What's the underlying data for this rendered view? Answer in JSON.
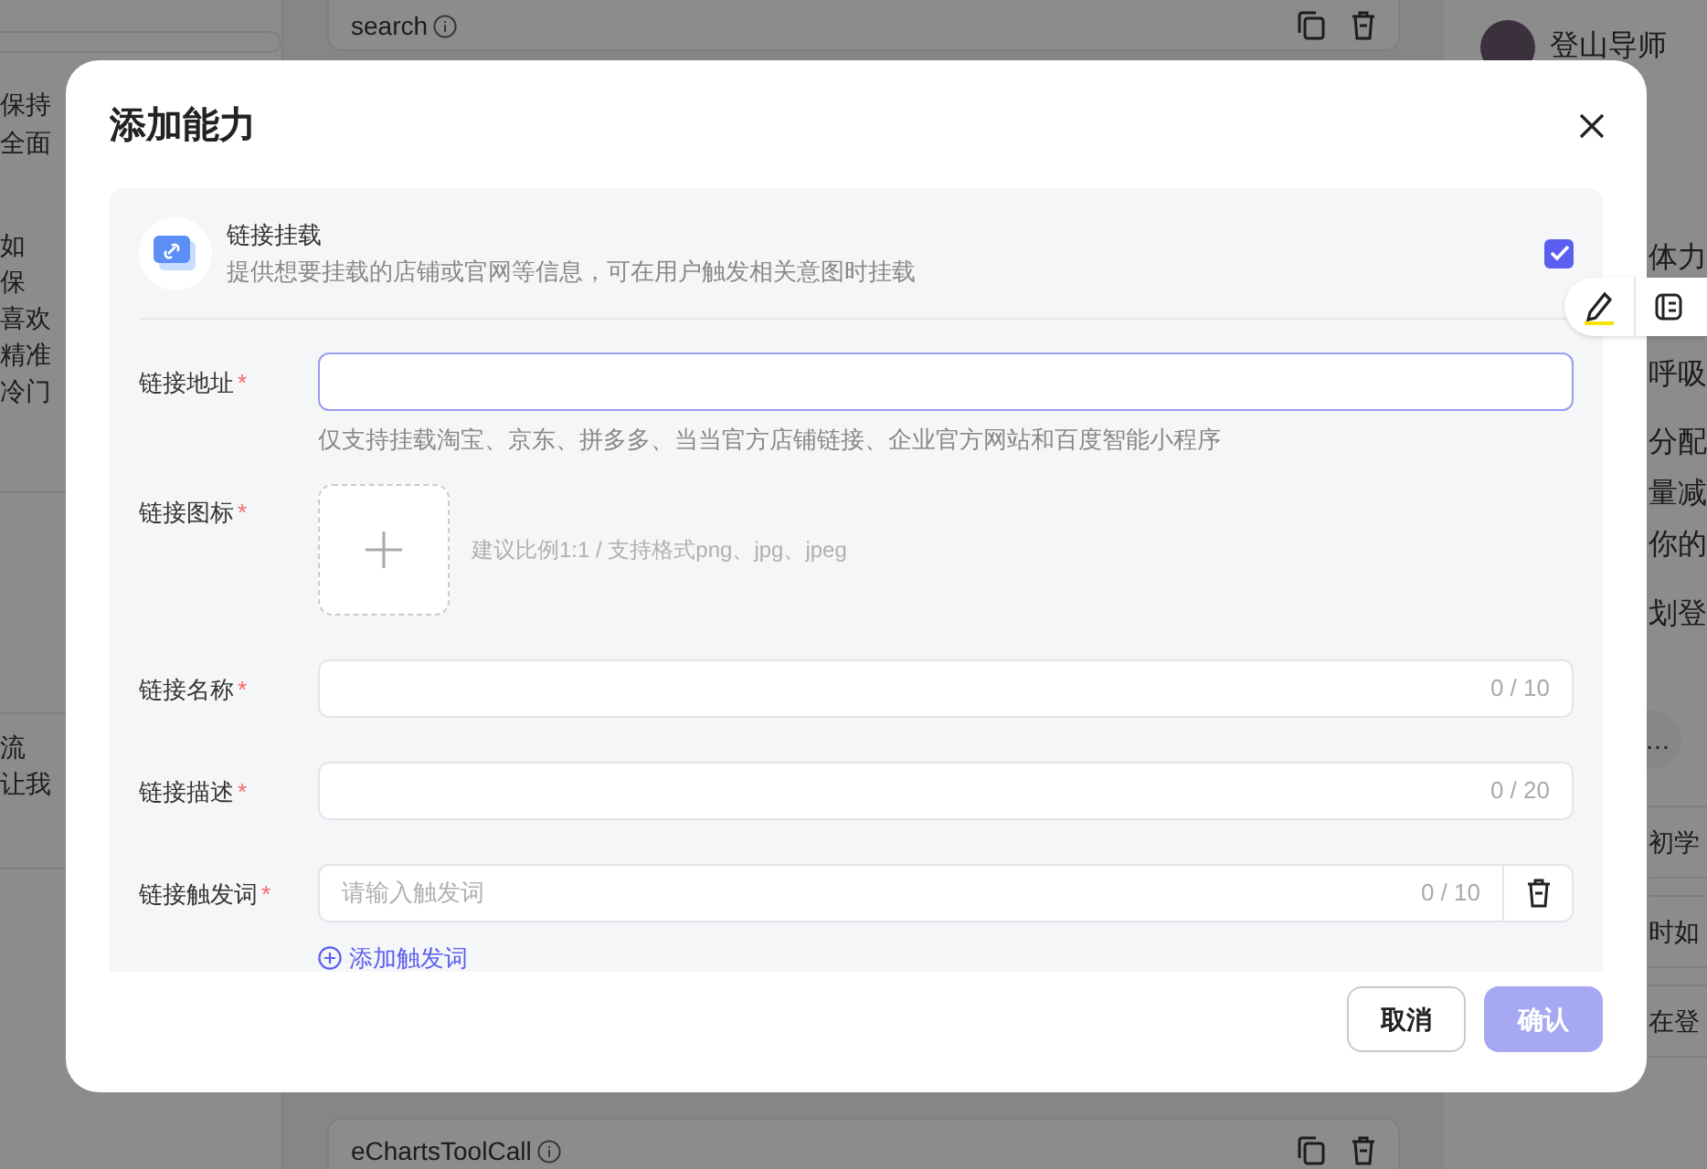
{
  "background": {
    "left_panel": {
      "card_1_lines": [
        "保持",
        "全面"
      ],
      "card_2_lines": [
        "如",
        "保",
        "喜欢",
        "精准",
        "冷门"
      ],
      "card_3_lines": [
        "流",
        "让我"
      ]
    },
    "plugins": [
      {
        "name": "search"
      },
      {
        "name": "eChartsToolCall"
      }
    ],
    "chat": {
      "agent_name": "登山导师",
      "lines": [
        "体力",
        "呼吸",
        "分配",
        "量减",
        "你的",
        "划登"
      ],
      "chip": "…",
      "questions": [
        "初学",
        "时如",
        "在登"
      ]
    }
  },
  "dialog": {
    "title": "添加能力",
    "ability": {
      "title": "链接挂载",
      "description": "提供想要挂载的店铺或官网等信息，可在用户触发相关意图时挂载",
      "checked": true
    },
    "fields": [
      {
        "kind": "text",
        "label": "链接地址",
        "required_mark": "*",
        "focused": true,
        "hint": "仅支持挂载淘宝、京东、拼多多、当当官方店铺链接、企业官方网站和百度智能小程序"
      },
      {
        "kind": "upload",
        "label": "链接图标",
        "required_mark": "*",
        "hint": "建议比例1:1 / 支持格式png、jpg、jpeg"
      },
      {
        "kind": "text",
        "label": "链接名称",
        "required_mark": "*",
        "focused": false,
        "counter": "0 / 10"
      },
      {
        "kind": "text",
        "label": "链接描述",
        "required_mark": "*",
        "focused": false,
        "counter": "0 / 20"
      },
      {
        "kind": "trigger",
        "label": "链接触发词",
        "required_mark": "*",
        "placeholder": "请输入触发词",
        "counter": "0 / 10"
      }
    ],
    "add_trigger": "添加触发词",
    "buttons": [
      {
        "label": "取消",
        "kind": "secondary",
        "disabled": false
      },
      {
        "label": "确认",
        "kind": "primary",
        "disabled": true
      }
    ]
  }
}
